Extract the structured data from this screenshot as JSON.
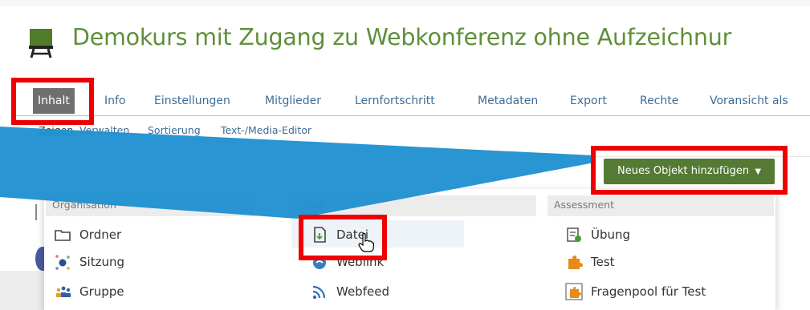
{
  "course": {
    "title": "Demokurs mit Zugang zu Webkonferenz ohne Aufzeichnur",
    "icon": "course-board-icon"
  },
  "tabs": [
    {
      "label": "Inhalt",
      "active": true
    },
    {
      "label": "Info"
    },
    {
      "label": "Einstellungen"
    },
    {
      "label": "Mitglieder"
    },
    {
      "label": "Lernfortschritt"
    },
    {
      "label": "Metadaten"
    },
    {
      "label": "Export"
    },
    {
      "label": "Rechte"
    },
    {
      "label": "Voransicht als"
    }
  ],
  "subtabs": [
    {
      "label": "Zeigen",
      "current": true
    },
    {
      "label": "Verwalten"
    },
    {
      "label": "Sortierung"
    },
    {
      "label": "Text-/Media-Editor"
    }
  ],
  "add_button": {
    "label": "Neues Objekt hinzufügen",
    "icon": "caret-down-icon"
  },
  "dropdown": {
    "columns": [
      {
        "header": "Organisation",
        "items": [
          {
            "label": "Ordner",
            "icon": "folder-icon"
          },
          {
            "label": "Sitzung",
            "icon": "session-icon"
          },
          {
            "label": "Gruppe",
            "icon": "group-icon"
          }
        ]
      },
      {
        "header": "Inhalt",
        "items": [
          {
            "label": "Datei",
            "icon": "file-icon",
            "highlighted": true
          },
          {
            "label": "Weblink",
            "icon": "weblink-icon"
          },
          {
            "label": "Webfeed",
            "icon": "rss-icon"
          }
        ]
      },
      {
        "header": "Assessment",
        "items": [
          {
            "label": "Übung",
            "icon": "exercise-icon"
          },
          {
            "label": "Test",
            "icon": "puzzle-icon"
          },
          {
            "label": "Fragenpool für Test",
            "icon": "question-pool-icon"
          }
        ]
      }
    ]
  },
  "colors": {
    "accent_green": "#5f8f38",
    "button_green": "#547a33",
    "link_blue": "#3d6c95",
    "annotation_red": "#ee0000",
    "pointer_blue": "#1e8fd0"
  }
}
